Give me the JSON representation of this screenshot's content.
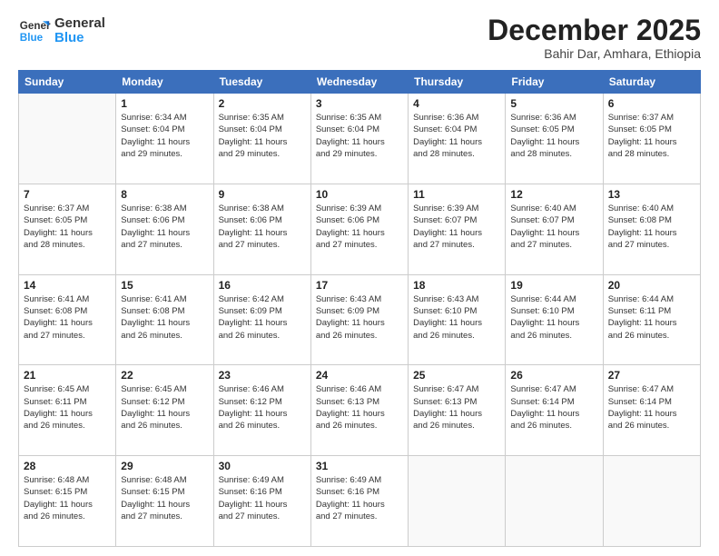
{
  "header": {
    "logo_general": "General",
    "logo_blue": "Blue",
    "month_title": "December 2025",
    "location": "Bahir Dar, Amhara, Ethiopia"
  },
  "days_of_week": [
    "Sunday",
    "Monday",
    "Tuesday",
    "Wednesday",
    "Thursday",
    "Friday",
    "Saturday"
  ],
  "weeks": [
    [
      {
        "day": "",
        "info": ""
      },
      {
        "day": "1",
        "info": "Sunrise: 6:34 AM\nSunset: 6:04 PM\nDaylight: 11 hours\nand 29 minutes."
      },
      {
        "day": "2",
        "info": "Sunrise: 6:35 AM\nSunset: 6:04 PM\nDaylight: 11 hours\nand 29 minutes."
      },
      {
        "day": "3",
        "info": "Sunrise: 6:35 AM\nSunset: 6:04 PM\nDaylight: 11 hours\nand 29 minutes."
      },
      {
        "day": "4",
        "info": "Sunrise: 6:36 AM\nSunset: 6:04 PM\nDaylight: 11 hours\nand 28 minutes."
      },
      {
        "day": "5",
        "info": "Sunrise: 6:36 AM\nSunset: 6:05 PM\nDaylight: 11 hours\nand 28 minutes."
      },
      {
        "day": "6",
        "info": "Sunrise: 6:37 AM\nSunset: 6:05 PM\nDaylight: 11 hours\nand 28 minutes."
      }
    ],
    [
      {
        "day": "7",
        "info": "Sunrise: 6:37 AM\nSunset: 6:05 PM\nDaylight: 11 hours\nand 28 minutes."
      },
      {
        "day": "8",
        "info": "Sunrise: 6:38 AM\nSunset: 6:06 PM\nDaylight: 11 hours\nand 27 minutes."
      },
      {
        "day": "9",
        "info": "Sunrise: 6:38 AM\nSunset: 6:06 PM\nDaylight: 11 hours\nand 27 minutes."
      },
      {
        "day": "10",
        "info": "Sunrise: 6:39 AM\nSunset: 6:06 PM\nDaylight: 11 hours\nand 27 minutes."
      },
      {
        "day": "11",
        "info": "Sunrise: 6:39 AM\nSunset: 6:07 PM\nDaylight: 11 hours\nand 27 minutes."
      },
      {
        "day": "12",
        "info": "Sunrise: 6:40 AM\nSunset: 6:07 PM\nDaylight: 11 hours\nand 27 minutes."
      },
      {
        "day": "13",
        "info": "Sunrise: 6:40 AM\nSunset: 6:08 PM\nDaylight: 11 hours\nand 27 minutes."
      }
    ],
    [
      {
        "day": "14",
        "info": "Sunrise: 6:41 AM\nSunset: 6:08 PM\nDaylight: 11 hours\nand 27 minutes."
      },
      {
        "day": "15",
        "info": "Sunrise: 6:41 AM\nSunset: 6:08 PM\nDaylight: 11 hours\nand 26 minutes."
      },
      {
        "day": "16",
        "info": "Sunrise: 6:42 AM\nSunset: 6:09 PM\nDaylight: 11 hours\nand 26 minutes."
      },
      {
        "day": "17",
        "info": "Sunrise: 6:43 AM\nSunset: 6:09 PM\nDaylight: 11 hours\nand 26 minutes."
      },
      {
        "day": "18",
        "info": "Sunrise: 6:43 AM\nSunset: 6:10 PM\nDaylight: 11 hours\nand 26 minutes."
      },
      {
        "day": "19",
        "info": "Sunrise: 6:44 AM\nSunset: 6:10 PM\nDaylight: 11 hours\nand 26 minutes."
      },
      {
        "day": "20",
        "info": "Sunrise: 6:44 AM\nSunset: 6:11 PM\nDaylight: 11 hours\nand 26 minutes."
      }
    ],
    [
      {
        "day": "21",
        "info": "Sunrise: 6:45 AM\nSunset: 6:11 PM\nDaylight: 11 hours\nand 26 minutes."
      },
      {
        "day": "22",
        "info": "Sunrise: 6:45 AM\nSunset: 6:12 PM\nDaylight: 11 hours\nand 26 minutes."
      },
      {
        "day": "23",
        "info": "Sunrise: 6:46 AM\nSunset: 6:12 PM\nDaylight: 11 hours\nand 26 minutes."
      },
      {
        "day": "24",
        "info": "Sunrise: 6:46 AM\nSunset: 6:13 PM\nDaylight: 11 hours\nand 26 minutes."
      },
      {
        "day": "25",
        "info": "Sunrise: 6:47 AM\nSunset: 6:13 PM\nDaylight: 11 hours\nand 26 minutes."
      },
      {
        "day": "26",
        "info": "Sunrise: 6:47 AM\nSunset: 6:14 PM\nDaylight: 11 hours\nand 26 minutes."
      },
      {
        "day": "27",
        "info": "Sunrise: 6:47 AM\nSunset: 6:14 PM\nDaylight: 11 hours\nand 26 minutes."
      }
    ],
    [
      {
        "day": "28",
        "info": "Sunrise: 6:48 AM\nSunset: 6:15 PM\nDaylight: 11 hours\nand 26 minutes."
      },
      {
        "day": "29",
        "info": "Sunrise: 6:48 AM\nSunset: 6:15 PM\nDaylight: 11 hours\nand 27 minutes."
      },
      {
        "day": "30",
        "info": "Sunrise: 6:49 AM\nSunset: 6:16 PM\nDaylight: 11 hours\nand 27 minutes."
      },
      {
        "day": "31",
        "info": "Sunrise: 6:49 AM\nSunset: 6:16 PM\nDaylight: 11 hours\nand 27 minutes."
      },
      {
        "day": "",
        "info": ""
      },
      {
        "day": "",
        "info": ""
      },
      {
        "day": "",
        "info": ""
      }
    ]
  ]
}
